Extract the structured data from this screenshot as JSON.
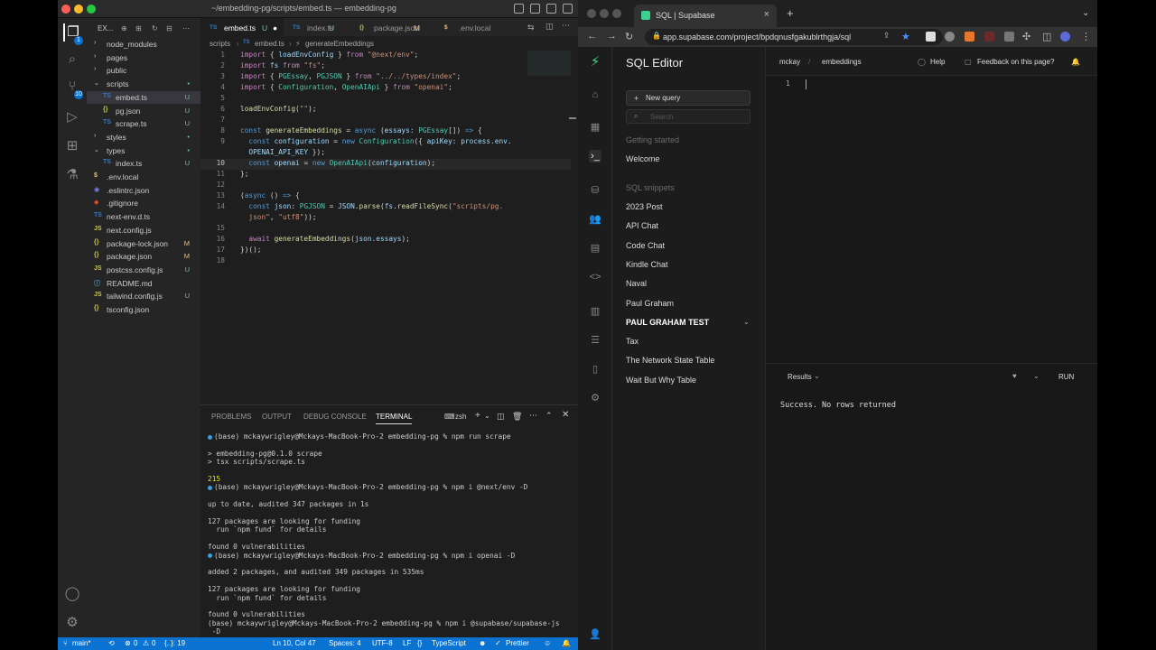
{
  "vscode": {
    "window_title": "~/embedding-pg/scripts/embed.ts — embedding-pg",
    "activity_badges": {
      "scm": "10",
      "accounts": "1"
    },
    "explorer_label": "EX...",
    "tree": [
      {
        "label": "node_modules",
        "kind": "folder",
        "depth": 0,
        "status": ""
      },
      {
        "label": "pages",
        "kind": "folder",
        "depth": 0,
        "status": ""
      },
      {
        "label": "public",
        "kind": "folder",
        "depth": 0,
        "status": ""
      },
      {
        "label": "scripts",
        "kind": "folder-open",
        "depth": 0,
        "status": "•"
      },
      {
        "label": "embed.ts",
        "kind": "ts",
        "depth": 1,
        "status": "U",
        "selected": true
      },
      {
        "label": "pg.json",
        "kind": "json",
        "depth": 1,
        "status": "U"
      },
      {
        "label": "scrape.ts",
        "kind": "ts",
        "depth": 1,
        "status": "U"
      },
      {
        "label": "styles",
        "kind": "folder",
        "depth": 0,
        "status": "•"
      },
      {
        "label": "types",
        "kind": "folder-open",
        "depth": 0,
        "status": "•"
      },
      {
        "label": "index.ts",
        "kind": "ts",
        "depth": 1,
        "status": "U"
      },
      {
        "label": ".env.local",
        "kind": "env",
        "depth": 0,
        "status": ""
      },
      {
        "label": ".eslintrc.json",
        "kind": "eslint",
        "depth": 0,
        "status": ""
      },
      {
        "label": ".gitignore",
        "kind": "git",
        "depth": 0,
        "status": ""
      },
      {
        "label": "next-env.d.ts",
        "kind": "ts",
        "depth": 0,
        "status": ""
      },
      {
        "label": "next.config.js",
        "kind": "js",
        "depth": 0,
        "status": ""
      },
      {
        "label": "package-lock.json",
        "kind": "json",
        "depth": 0,
        "status": "M"
      },
      {
        "label": "package.json",
        "kind": "json",
        "depth": 0,
        "status": "M"
      },
      {
        "label": "postcss.config.js",
        "kind": "js",
        "depth": 0,
        "status": "U"
      },
      {
        "label": "README.md",
        "kind": "md",
        "depth": 0,
        "status": ""
      },
      {
        "label": "tailwind.config.js",
        "kind": "js",
        "depth": 0,
        "status": "U"
      },
      {
        "label": "tsconfig.json",
        "kind": "json",
        "depth": 0,
        "status": ""
      }
    ],
    "tabs": [
      {
        "icon": "TS",
        "label": "embed.ts",
        "status": "U",
        "active": true
      },
      {
        "icon": "TS",
        "label": "index.ts",
        "status": "U"
      },
      {
        "icon": "{}",
        "label": "package.json",
        "status": "M"
      },
      {
        "icon": "$",
        "label": ".env.local",
        "status": ""
      }
    ],
    "breadcrumb": [
      "scripts",
      "embed.ts",
      "generateEmbeddings"
    ],
    "code_lines": [
      {
        "n": "1",
        "html": "<span class='kw'>import</span> { <span class='vr'>loadEnvConfig</span> } <span class='kw'>from</span> <span class='str'>\"@next/env\"</span>;"
      },
      {
        "n": "2",
        "html": "<span class='kw'>import</span> <span class='vr'>fs</span> <span class='kw'>from</span> <span class='str'>\"fs\"</span>;"
      },
      {
        "n": "3",
        "html": "<span class='kw'>import</span> { <span class='ty'>PGEssay</span>, <span class='ty'>PGJSON</span> } <span class='kw'>from</span> <span class='str'>\"../../types/index\"</span>;"
      },
      {
        "n": "4",
        "html": "<span class='kw'>import</span> { <span class='ty'>Configuration</span>, <span class='ty'>OpenAIApi</span> } <span class='kw'>from</span> <span class='str'>\"openai\"</span>;"
      },
      {
        "n": "5",
        "html": ""
      },
      {
        "n": "6",
        "html": "<span class='fn'>loadEnvConfig</span>(<span class='str'>\"\"</span>);"
      },
      {
        "n": "7",
        "html": ""
      },
      {
        "n": "8",
        "html": "<span class='kb'>const</span> <span class='fn'>generateEmbeddings</span> = <span class='kb'>async</span> (<span class='vr'>essays</span>: <span class='ty'>PGEssay</span>[]) <span class='kb'>=&gt;</span> {"
      },
      {
        "n": "9",
        "html": "  <span class='kb'>const</span> <span class='vr'>configuration</span> = <span class='kb'>new</span> <span class='ty'>Configuration</span>({ <span class='vr'>apiKey</span>: <span class='vr'>process</span>.<span class='vr'>env</span>."
      },
      {
        "n": "",
        "html": "  <span class='vr'>OPENAI_API_KEY</span> });"
      },
      {
        "n": "10",
        "html": "  <span class='kb'>const</span> <span class='vr'>openai</span> = <span class='kb'>new</span> <span class='ty'>OpenAIApi</span>(<span class='vr'>configuration</span>);"
      },
      {
        "n": "11",
        "html": "};"
      },
      {
        "n": "12",
        "html": ""
      },
      {
        "n": "13",
        "html": "(<span class='kb'>async</span> () <span class='kb'>=&gt;</span> {"
      },
      {
        "n": "14",
        "html": "  <span class='kb'>const</span> <span class='vr'>json</span>: <span class='ty'>PGJSON</span> = <span class='vr'>JSON</span>.<span class='fn'>parse</span>(<span class='vr'>fs</span>.<span class='fn'>readFileSync</span>(<span class='str'>\"scripts/pg.</span>"
      },
      {
        "n": "",
        "html": "  <span class='str'>json\"</span>, <span class='str'>\"utf8\"</span>));"
      },
      {
        "n": "15",
        "html": ""
      },
      {
        "n": "16",
        "html": "  <span class='kw'>await</span> <span class='fn'>generateEmbeddings</span>(<span class='vr'>json</span>.<span class='vr'>essays</span>);"
      },
      {
        "n": "17",
        "html": "})();"
      },
      {
        "n": "18",
        "html": ""
      }
    ],
    "panel_tabs": [
      "PROBLEMS",
      "OUTPUT",
      "DEBUG CONSOLE",
      "TERMINAL"
    ],
    "terminal_shell": "zsh",
    "terminal_lines": [
      {
        "dot": true,
        "text": "(base) mckaywrigley@Mckays-MacBook-Pro-2 embedding-pg % npm run scrape"
      },
      {
        "dot": false,
        "text": ""
      },
      {
        "dot": false,
        "text": "> embedding-pg@0.1.0 scrape"
      },
      {
        "dot": false,
        "text": "> tsx scripts/scrape.ts"
      },
      {
        "dot": false,
        "text": ""
      },
      {
        "dot": false,
        "text": "215",
        "color": "#e5e510"
      },
      {
        "dot": true,
        "text": "(base) mckaywrigley@Mckays-MacBook-Pro-2 embedding-pg % npm i @next/env -D"
      },
      {
        "dot": false,
        "text": ""
      },
      {
        "dot": false,
        "text": "up to date, audited 347 packages in 1s"
      },
      {
        "dot": false,
        "text": ""
      },
      {
        "dot": false,
        "text": "127 packages are looking for funding"
      },
      {
        "dot": false,
        "text": "  run `npm fund` for details"
      },
      {
        "dot": false,
        "text": ""
      },
      {
        "dot": false,
        "text": "found 0 vulnerabilities"
      },
      {
        "dot": true,
        "text": "(base) mckaywrigley@Mckays-MacBook-Pro-2 embedding-pg % npm i openai -D"
      },
      {
        "dot": false,
        "text": ""
      },
      {
        "dot": false,
        "text": "added 2 packages, and audited 349 packages in 535ms"
      },
      {
        "dot": false,
        "text": ""
      },
      {
        "dot": false,
        "text": "127 packages are looking for funding"
      },
      {
        "dot": false,
        "text": "  run `npm fund` for details"
      },
      {
        "dot": false,
        "text": ""
      },
      {
        "dot": false,
        "text": "found 0 vulnerabilities"
      },
      {
        "dot": false,
        "text": "(base) mckaywrigley@Mckays-MacBook-Pro-2 embedding-pg % npm i @supabase/supabase-js"
      },
      {
        "dot": false,
        "text": " -D"
      }
    ],
    "status": {
      "branch": "main*",
      "problems": "0",
      "warnings": "0",
      "selection": "{..}: 19",
      "cursor": "Ln 10, Col 47",
      "spaces": "Spaces: 4",
      "encoding": "UTF-8",
      "eol": "LF",
      "language": "TypeScript",
      "formatter": "Prettier"
    }
  },
  "browser": {
    "tab_title": "SQL | Supabase",
    "url": "app.supabase.com/project/bpdqnusfgakublrthgja/sql",
    "page_title": "SQL Editor",
    "new_query": "New query",
    "search_placeholder": "Search",
    "section_getting_started": "Getting started",
    "welcome": "Welcome",
    "section_snippets": "SQL snippets",
    "snippets": [
      "2023 Post",
      "API Chat",
      "Code Chat",
      "Kindle Chat",
      "Naval",
      "Paul Graham",
      "PAUL GRAHAM TEST",
      "Tax",
      "The Network State Table",
      "Wait But Why Table"
    ],
    "active_snippet": "PAUL GRAHAM TEST",
    "breadcrumb_org": "mckay",
    "breadcrumb_project": "embeddings",
    "help": "Help",
    "feedback": "Feedback on this page?",
    "editor_line": "1",
    "results_tab": "Results",
    "run": "RUN",
    "result_message": "Success. No rows returned",
    "accent": "#3ecf8e"
  }
}
